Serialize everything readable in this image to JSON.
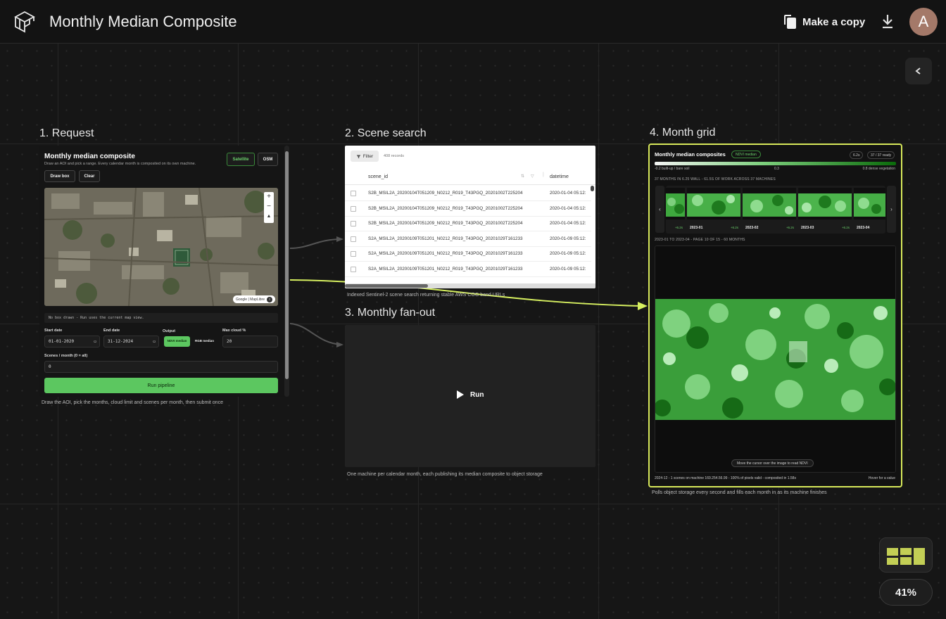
{
  "header": {
    "title": "Monthly Median Composite",
    "copy_label": "Make a copy",
    "avatar_initial": "A"
  },
  "canvas": {
    "zoom_level": "41%"
  },
  "sections": {
    "request": "1. Request",
    "scene_search": "2. Scene search",
    "fanout": "3. Monthly fan-out",
    "month_grid": "4. Month grid"
  },
  "captions": {
    "request": "Draw the AOI, pick the months, cloud limit and scenes per month, then submit once",
    "scene_search": "Indexed Sentinel-2 scene search returning stable AWS COG band URLs",
    "fanout": "One machine per calendar month, each publishing its median composite to object storage",
    "month_grid": "Polls object storage every second and fills each month in as its machine finishes"
  },
  "request_card": {
    "title": "Monthly median composite",
    "subtitle": "Draw an AOI and pick a range. Every calendar month is composited on its own machine.",
    "satellite_label": "Satellite",
    "osm_label": "OSM",
    "draw_box_label": "Draw box",
    "clear_label": "Clear",
    "map_attribution": "Google | MapLibre",
    "status_message": "No box drawn - Run uses the current map view.",
    "start_date_label": "Start date",
    "start_date_value": "01-01-2020",
    "end_date_label": "End date",
    "end_date_value": "31-12-2024",
    "output_label": "Output",
    "output_ndvi": "NDVI median",
    "output_rgb": "RGB median",
    "max_cloud_label": "Max cloud %",
    "max_cloud_value": "20",
    "scenes_label": "Scenes / month (0 = all)",
    "scenes_value": "0",
    "run_label": "Run pipeline"
  },
  "scene_card": {
    "filter_label": "Filter",
    "record_count": "408 records",
    "columns": [
      "scene_id",
      "datetime"
    ],
    "rows": [
      {
        "scene_id": "S2B_MSIL2A_20200104T051209_N0212_R019_T43PGQ_20201002T225204",
        "datetime": "2020-01-04 05:12:"
      },
      {
        "scene_id": "S2B_MSIL2A_20200104T051209_N0212_R019_T43PGQ_20201002T225204",
        "datetime": "2020-01-04 05:12:"
      },
      {
        "scene_id": "S2B_MSIL2A_20200104T051209_N0212_R019_T43PGQ_20201002T225204",
        "datetime": "2020-01-04 05:12:"
      },
      {
        "scene_id": "S2A_MSIL2A_20200109T051201_N0212_R019_T43PGQ_20201029T161233",
        "datetime": "2020-01-09 05:12:"
      },
      {
        "scene_id": "S2A_MSIL2A_20200109T051201_N0212_R019_T43PGQ_20201029T161233",
        "datetime": "2020-01-09 05:12:"
      },
      {
        "scene_id": "S2A_MSIL2A_20200109T051201_N0212_R019_T43PGQ_20201029T161233",
        "datetime": "2020-01-09 05:12:"
      }
    ]
  },
  "fanout_card": {
    "run_label": "Run"
  },
  "grid_card": {
    "title": "Monthly median composites",
    "badge": "NDVI median",
    "wall_time": "6.2s",
    "ready": "37 / 37 ready",
    "legend_left": "-0.2 built-up / bare soil",
    "legend_mid": "0.3",
    "legend_right": "0.8 dense vegetation",
    "summary": "37 MONTHS IN 6.25 WALL - 61.5S OF WORK ACROSS 37 MACHINES",
    "thumbs": [
      {
        "name": "",
        "time": "+6.2s"
      },
      {
        "name": "2023-01",
        "time": "+6.2s"
      },
      {
        "name": "2023-02",
        "time": "+6.2s"
      },
      {
        "name": "2023-03",
        "time": "+6.2s"
      },
      {
        "name": "2023-04",
        "time": ""
      }
    ],
    "page_info": "2023-01 TO 2023-04 - PAGE 10 OF 15 - 60 MONTHS",
    "hover_hint": "Move the cursor over the image to read NDVI",
    "footer_left": "2024-12 - 1 scenes on machine 169.254.56.99 - 100% of pixels valid - composited in 1.58s",
    "footer_right": "Hover for a value"
  },
  "colors": {
    "accent_green": "#5cc760",
    "highlight_border": "#d7e85a",
    "avatar_bg": "#a47969"
  }
}
